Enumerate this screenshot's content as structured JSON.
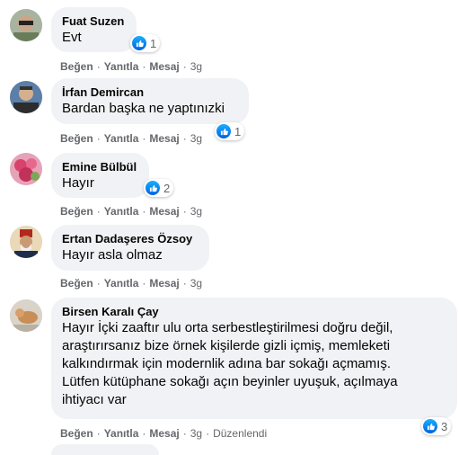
{
  "comments": [
    {
      "author": "Fuat Suzen",
      "text": "Evt",
      "reactions": "1",
      "time": "3g"
    },
    {
      "author": "İrfan Demircan",
      "text": "Bardan başka ne yaptınızki",
      "reactions": "1",
      "time": "3g"
    },
    {
      "author": "Emine Bülbül",
      "text": "Hayır",
      "reactions": "2",
      "time": "3g"
    },
    {
      "author": "Ertan Dadaşeres Özsoy",
      "text": "Hayır asla olmaz",
      "reactions": "",
      "time": "3g"
    },
    {
      "author": "Birsen Karalı Çay",
      "text": "Hayır İçki zaaftır ulu orta serbestleştirilmesi doğru değil,\naraştırırsanız bize örnek kişilerde gizli içmiş, memleketi\nkalkındırmak için modernlik adına bar sokağı açmamış.\nLütfen kütüphane sokağı açın beyinler uyuşuk, açılmaya\nihtiyacı var",
      "reactions": "3",
      "time": "3g",
      "edited": "Düzenlendi"
    }
  ],
  "actions": {
    "like": "Beğen",
    "reply": "Yanıtla",
    "message": "Mesaj",
    "separator": "·"
  },
  "colors": {
    "bubble": "#f0f2f5",
    "secondary": "#65676b",
    "like": "#1877f2"
  }
}
